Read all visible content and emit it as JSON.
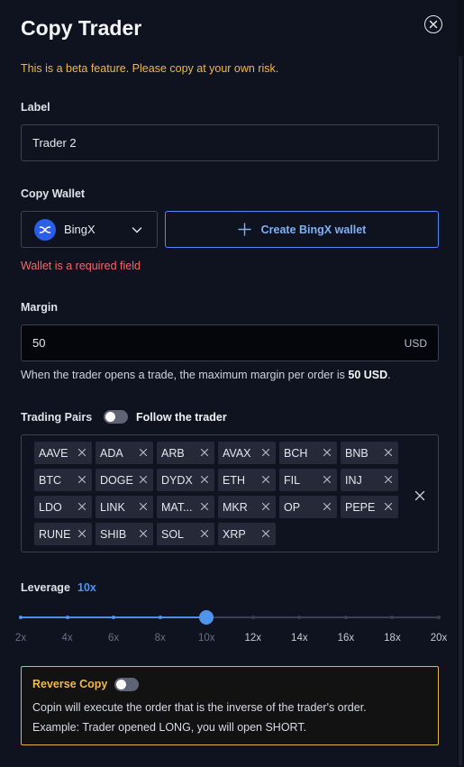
{
  "header": {
    "title": "Copy Trader"
  },
  "notice": "This is a beta feature. Please copy at your own risk.",
  "label_field": {
    "label": "Label",
    "value": "Trader 2"
  },
  "wallet": {
    "label": "Copy Wallet",
    "selected": "BingX",
    "create_button": "Create BingX wallet",
    "error": "Wallet is a required field"
  },
  "margin": {
    "label": "Margin",
    "value": "50",
    "unit": "USD",
    "hint_prefix": "When the trader opens a trade, the maximum margin per order is ",
    "hint_value": "50 USD",
    "hint_suffix": "."
  },
  "trading_pairs": {
    "label": "Trading Pairs",
    "follow_label": "Follow the trader",
    "follow_enabled": false,
    "pairs": [
      "AAVE",
      "ADA",
      "ARB",
      "AVAX",
      "BCH",
      "BNB",
      "BTC",
      "DOGE",
      "DYDX",
      "ETH",
      "FIL",
      "INJ",
      "LDO",
      "LINK",
      "MAT...",
      "MKR",
      "OP",
      "PEPE",
      "RUNE",
      "SHIB",
      "SOL",
      "XRP"
    ]
  },
  "leverage": {
    "label": "Leverage",
    "value_label": "10x",
    "value": 10,
    "ticks": [
      "2x",
      "4x",
      "6x",
      "8x",
      "10x",
      "12x",
      "14x",
      "16x",
      "18x",
      "20x"
    ]
  },
  "reverse_copy": {
    "title": "Reverse Copy",
    "enabled": false,
    "line1": "Copin will execute the order that is the inverse of the trader's order.",
    "line2": "Example: Trader opened LONG, you will open SHORT."
  },
  "colors": {
    "accent": "#4f95f0",
    "warning": "#f0b84a",
    "error": "#f26a66"
  }
}
